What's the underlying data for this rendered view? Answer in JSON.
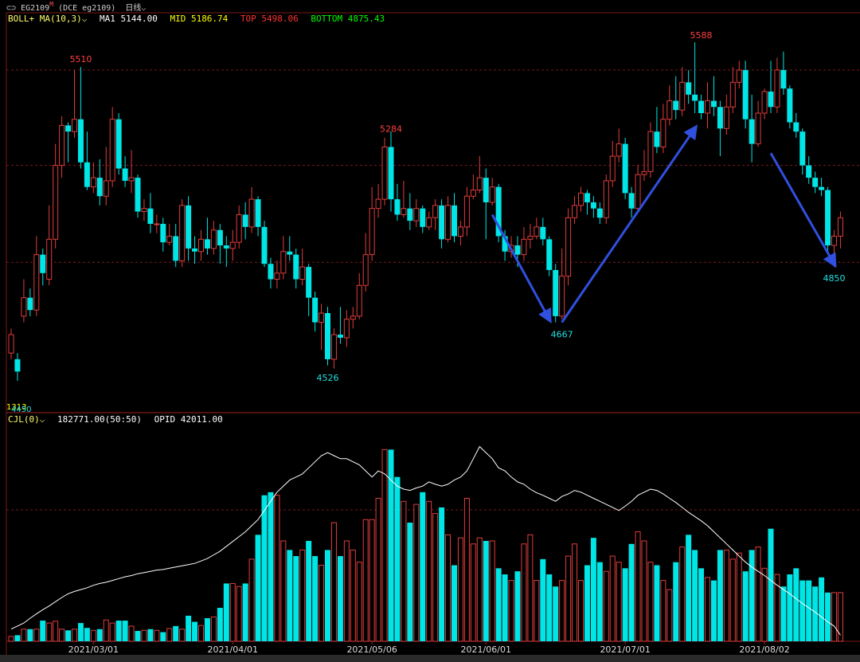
{
  "header": {
    "symbol": "EG2109",
    "suffix": "M",
    "exchange": "(DCE eg2109)",
    "period": "日线",
    "colors": {
      "up": "#e03c3c",
      "down": "#00e5e5",
      "arrow": "#3050e0",
      "grid": "#7a1818"
    }
  },
  "indicator_top": {
    "name": "BOLL+ MA(10,3)",
    "ma1": "MA1 5144.00",
    "mid": "MID 5186.74",
    "top": "TOP 5498.06",
    "bottom": "BOTTOM 4875.43",
    "colors": {
      "name": "#ffffff",
      "ma1": "#ffffff",
      "mid": "#ffff00",
      "top": "#ff3030",
      "bottom": "#00ff00"
    }
  },
  "indicator_bottom": {
    "name": "CJL(0)",
    "volume": "182771.00(50:50)",
    "opid": "OPID 42011.00"
  },
  "chart_data": {
    "type": "candlestick",
    "price_range": [
      4420,
      5650
    ],
    "x_tick_labels": [
      {
        "label": "2021/03/01",
        "index": 13
      },
      {
        "label": "2021/04/01",
        "index": 35
      },
      {
        "label": "2021/05/06",
        "index": 57
      },
      {
        "label": "2021/06/01",
        "index": 75
      },
      {
        "label": "2021/07/01",
        "index": 97
      },
      {
        "label": "2021/08/02",
        "index": 119
      }
    ],
    "annotations": [
      {
        "text": "5510",
        "index": 11,
        "price": 5510,
        "color": "#ff4040",
        "position": "above"
      },
      {
        "text": "5284",
        "index": 60,
        "price": 5284,
        "color": "#ff4040",
        "position": "above"
      },
      {
        "text": "4526",
        "index": 50,
        "price": 4526,
        "color": "#20e0e0",
        "position": "below"
      },
      {
        "text": "4667",
        "index": 87,
        "price": 4667,
        "color": "#20e0e0",
        "position": "below"
      },
      {
        "text": "5588",
        "index": 109,
        "price": 5588,
        "color": "#ff4040",
        "position": "above"
      },
      {
        "text": "4850",
        "index": 130,
        "price": 4850,
        "color": "#20e0e0",
        "position": "below"
      }
    ],
    "left_edge_labels": [
      "1313",
      "4450"
    ],
    "arrows": [
      {
        "from": {
          "index": 76,
          "price": 5030
        },
        "to": {
          "index": 85,
          "price": 4690
        }
      },
      {
        "from": {
          "index": 87,
          "price": 4680
        },
        "to": {
          "index": 108,
          "price": 5310
        }
      },
      {
        "from": {
          "index": 120,
          "price": 5230
        },
        "to": {
          "index": 130,
          "price": 4870
        }
      }
    ],
    "price_grid": [
      5500,
      5190,
      4875
    ],
    "volume_grid_fraction": [
      0.6
    ],
    "candles": [
      [
        4580,
        4640,
        4560,
        4660
      ],
      [
        4560,
        4520,
        4490,
        4580
      ],
      [
        4700,
        4760,
        4680,
        4820
      ],
      [
        4760,
        4720,
        4700,
        4790
      ],
      [
        4720,
        4900,
        4700,
        4960
      ],
      [
        4900,
        4840,
        4800,
        4920
      ],
      [
        4820,
        4950,
        4800,
        5060
      ],
      [
        4950,
        5190,
        4920,
        5260
      ],
      [
        5190,
        5320,
        5150,
        5350
      ],
      [
        5320,
        5300,
        5200,
        5330
      ],
      [
        5300,
        5340,
        5280,
        5500
      ],
      [
        5340,
        5200,
        5180,
        5510
      ],
      [
        5200,
        5120,
        5110,
        5300
      ],
      [
        5120,
        5150,
        5100,
        5200
      ],
      [
        5150,
        5090,
        5060,
        5210
      ],
      [
        5090,
        5140,
        5060,
        5250
      ],
      [
        5140,
        5340,
        5120,
        5380
      ],
      [
        5340,
        5180,
        5160,
        5360
      ],
      [
        5180,
        5140,
        5120,
        5220
      ],
      [
        5140,
        5150,
        5100,
        5240
      ],
      [
        5150,
        5040,
        5020,
        5160
      ],
      [
        5040,
        5050,
        5010,
        5080
      ],
      [
        5050,
        5000,
        4970,
        5100
      ],
      [
        5000,
        5000,
        4970,
        5030
      ],
      [
        5000,
        4940,
        4910,
        5020
      ],
      [
        4940,
        4960,
        4930,
        5000
      ],
      [
        4960,
        4880,
        4860,
        5000
      ],
      [
        4880,
        5060,
        4860,
        5080
      ],
      [
        5060,
        4920,
        4880,
        5090
      ],
      [
        4920,
        4910,
        4870,
        4960
      ],
      [
        4910,
        4950,
        4880,
        4980
      ],
      [
        4950,
        4920,
        4900,
        5020
      ],
      [
        4920,
        4980,
        4900,
        5010
      ],
      [
        4980,
        4930,
        4870,
        5000
      ],
      [
        4930,
        4920,
        4860,
        4960
      ],
      [
        4920,
        4940,
        4880,
        4980
      ],
      [
        4940,
        5030,
        4920,
        5060
      ],
      [
        5030,
        4990,
        4950,
        5070
      ],
      [
        4990,
        5080,
        4970,
        5120
      ],
      [
        5080,
        4990,
        4960,
        5090
      ],
      [
        4990,
        4870,
        4860,
        5010
      ],
      [
        4870,
        4820,
        4790,
        4890
      ],
      [
        4820,
        4840,
        4790,
        4880
      ],
      [
        4840,
        4910,
        4820,
        4960
      ],
      [
        4910,
        4900,
        4880,
        4960
      ],
      [
        4900,
        4820,
        4790,
        4920
      ],
      [
        4820,
        4860,
        4800,
        4920
      ],
      [
        4860,
        4760,
        4700,
        4870
      ],
      [
        4760,
        4680,
        4650,
        4780
      ],
      [
        4680,
        4710,
        4590,
        4740
      ],
      [
        4710,
        4560,
        4540,
        4730
      ],
      [
        4560,
        4640,
        4530,
        4660
      ],
      [
        4640,
        4630,
        4610,
        4730
      ],
      [
        4630,
        4690,
        4600,
        4720
      ],
      [
        4690,
        4700,
        4660,
        4730
      ],
      [
        4700,
        4800,
        4690,
        4840
      ],
      [
        4800,
        4900,
        4780,
        4970
      ],
      [
        4900,
        5050,
        4880,
        5120
      ],
      [
        5050,
        5080,
        5020,
        5130
      ],
      [
        5080,
        5250,
        5060,
        5280
      ],
      [
        5250,
        5080,
        5040,
        5300
      ],
      [
        5080,
        5030,
        5010,
        5130
      ],
      [
        5030,
        5050,
        5020,
        5140
      ],
      [
        5050,
        5010,
        4980,
        5100
      ],
      [
        5010,
        5050,
        4990,
        5080
      ],
      [
        5050,
        4990,
        4970,
        5060
      ],
      [
        4990,
        5020,
        4980,
        5040
      ],
      [
        5020,
        5060,
        4980,
        5080
      ],
      [
        5060,
        4950,
        4920,
        5080
      ],
      [
        4950,
        5060,
        4940,
        5090
      ],
      [
        5060,
        4960,
        4940,
        5100
      ],
      [
        4960,
        4990,
        4930,
        5010
      ],
      [
        4990,
        5090,
        4960,
        5120
      ],
      [
        5090,
        5110,
        5080,
        5160
      ],
      [
        5110,
        5150,
        5100,
        5220
      ],
      [
        5150,
        5070,
        4950,
        5180
      ],
      [
        5070,
        5120,
        5060,
        5150
      ],
      [
        5120,
        4960,
        4940,
        5130
      ],
      [
        4960,
        4910,
        4880,
        4980
      ],
      [
        4910,
        4930,
        4890,
        4960
      ],
      [
        4930,
        4900,
        4860,
        4960
      ],
      [
        4900,
        4950,
        4880,
        4990
      ],
      [
        4950,
        4960,
        4920,
        5000
      ],
      [
        4960,
        4990,
        4950,
        5020
      ],
      [
        4990,
        4950,
        4930,
        5020
      ],
      [
        4950,
        4850,
        4830,
        4960
      ],
      [
        4850,
        4700,
        4680,
        4870
      ],
      [
        4700,
        4830,
        4690,
        4920
      ],
      [
        4830,
        5020,
        4800,
        5050
      ],
      [
        5020,
        5060,
        5000,
        5090
      ],
      [
        5060,
        5100,
        5040,
        5120
      ],
      [
        5100,
        5070,
        5030,
        5110
      ],
      [
        5070,
        5050,
        5020,
        5090
      ],
      [
        5050,
        5020,
        5000,
        5070
      ],
      [
        5020,
        5140,
        5000,
        5160
      ],
      [
        5140,
        5220,
        5120,
        5270
      ],
      [
        5220,
        5260,
        5200,
        5310
      ],
      [
        5260,
        5100,
        5080,
        5280
      ],
      [
        5100,
        5050,
        5020,
        5120
      ],
      [
        5050,
        5160,
        5040,
        5190
      ],
      [
        5160,
        5170,
        5140,
        5240
      ],
      [
        5170,
        5300,
        5150,
        5330
      ],
      [
        5300,
        5250,
        5230,
        5380
      ],
      [
        5250,
        5340,
        5230,
        5390
      ],
      [
        5340,
        5400,
        5320,
        5450
      ],
      [
        5400,
        5370,
        5340,
        5480
      ],
      [
        5370,
        5460,
        5350,
        5510
      ],
      [
        5460,
        5420,
        5390,
        5500
      ],
      [
        5420,
        5400,
        5360,
        5590
      ],
      [
        5400,
        5360,
        5340,
        5420
      ],
      [
        5360,
        5400,
        5310,
        5460
      ],
      [
        5400,
        5380,
        5350,
        5480
      ],
      [
        5380,
        5310,
        5220,
        5400
      ],
      [
        5310,
        5380,
        5290,
        5420
      ],
      [
        5380,
        5460,
        5360,
        5510
      ],
      [
        5460,
        5500,
        5440,
        5530
      ],
      [
        5500,
        5340,
        5310,
        5530
      ],
      [
        5340,
        5260,
        5200,
        5420
      ],
      [
        5260,
        5360,
        5250,
        5400
      ],
      [
        5360,
        5430,
        5340,
        5440
      ],
      [
        5430,
        5380,
        5360,
        5530
      ],
      [
        5380,
        5500,
        5360,
        5540
      ],
      [
        5500,
        5440,
        5420,
        5560
      ],
      [
        5440,
        5330,
        5310,
        5450
      ],
      [
        5330,
        5300,
        5280,
        5360
      ],
      [
        5300,
        5190,
        5160,
        5310
      ],
      [
        5190,
        5150,
        5130,
        5220
      ],
      [
        5150,
        5120,
        5100,
        5170
      ],
      [
        5120,
        5110,
        5090,
        5150
      ],
      [
        5110,
        4930,
        4900,
        5120
      ],
      [
        4930,
        4960,
        4860,
        4980
      ],
      [
        4960,
        5020,
        4920,
        5040
      ]
    ],
    "volume_range": [
      0,
      360000
    ],
    "volume": [
      8000,
      10000,
      20000,
      20000,
      20000,
      34000,
      30000,
      33000,
      20000,
      18000,
      20000,
      30000,
      22000,
      18000,
      20000,
      35000,
      30000,
      34000,
      34000,
      25000,
      17000,
      18000,
      20000,
      18000,
      15000,
      21000,
      25000,
      20000,
      42000,
      32000,
      26000,
      38000,
      40000,
      55000,
      95000,
      95000,
      90000,
      95000,
      135000,
      175000,
      240000,
      245000,
      240000,
      165000,
      150000,
      140000,
      150000,
      165000,
      140000,
      125000,
      150000,
      195000,
      140000,
      165000,
      150000,
      130000,
      200000,
      200000,
      235000,
      315000,
      315000,
      270000,
      230000,
      195000,
      225000,
      245000,
      230000,
      210000,
      220000,
      175000,
      125000,
      170000,
      235000,
      160000,
      170000,
      165000,
      165000,
      120000,
      110000,
      100000,
      115000,
      160000,
      175000,
      100000,
      135000,
      110000,
      90000,
      100000,
      140000,
      160000,
      100000,
      125000,
      170000,
      130000,
      115000,
      140000,
      130000,
      120000,
      160000,
      180000,
      165000,
      130000,
      125000,
      100000,
      85000,
      130000,
      155000,
      175000,
      150000,
      120000,
      105000,
      100000,
      150000,
      150000,
      135000,
      145000,
      115000,
      150000,
      155000,
      120000,
      185000,
      110000,
      90000,
      110000,
      120000,
      100000,
      100000,
      90000,
      105000,
      80000,
      80000,
      80000
    ],
    "oi_range": [
      0,
      360000
    ],
    "open_interest": [
      20000,
      25000,
      30000,
      38000,
      45000,
      52000,
      58000,
      65000,
      72000,
      78000,
      82000,
      85000,
      88000,
      92000,
      95000,
      97000,
      100000,
      103000,
      106000,
      108000,
      111000,
      113000,
      115000,
      117000,
      118000,
      120000,
      122000,
      124000,
      126000,
      128000,
      132000,
      136000,
      142000,
      148000,
      156000,
      164000,
      172000,
      180000,
      190000,
      200000,
      215000,
      230000,
      245000,
      255000,
      265000,
      270000,
      275000,
      285000,
      295000,
      305000,
      310000,
      305000,
      300000,
      300000,
      295000,
      290000,
      280000,
      270000,
      280000,
      275000,
      265000,
      255000,
      250000,
      248000,
      252000,
      255000,
      262000,
      258000,
      255000,
      258000,
      265000,
      270000,
      280000,
      300000,
      320000,
      310000,
      300000,
      285000,
      280000,
      270000,
      262000,
      258000,
      250000,
      244000,
      240000,
      235000,
      230000,
      238000,
      242000,
      248000,
      245000,
      240000,
      235000,
      230000,
      225000,
      220000,
      215000,
      222000,
      230000,
      240000,
      245000,
      250000,
      248000,
      242000,
      235000,
      228000,
      220000,
      212000,
      205000,
      198000,
      190000,
      180000,
      170000,
      160000,
      150000,
      140000,
      130000,
      122000,
      115000,
      108000,
      100000,
      92000,
      85000,
      78000,
      70000,
      62000,
      55000,
      48000,
      40000,
      32000,
      25000,
      10000
    ]
  }
}
